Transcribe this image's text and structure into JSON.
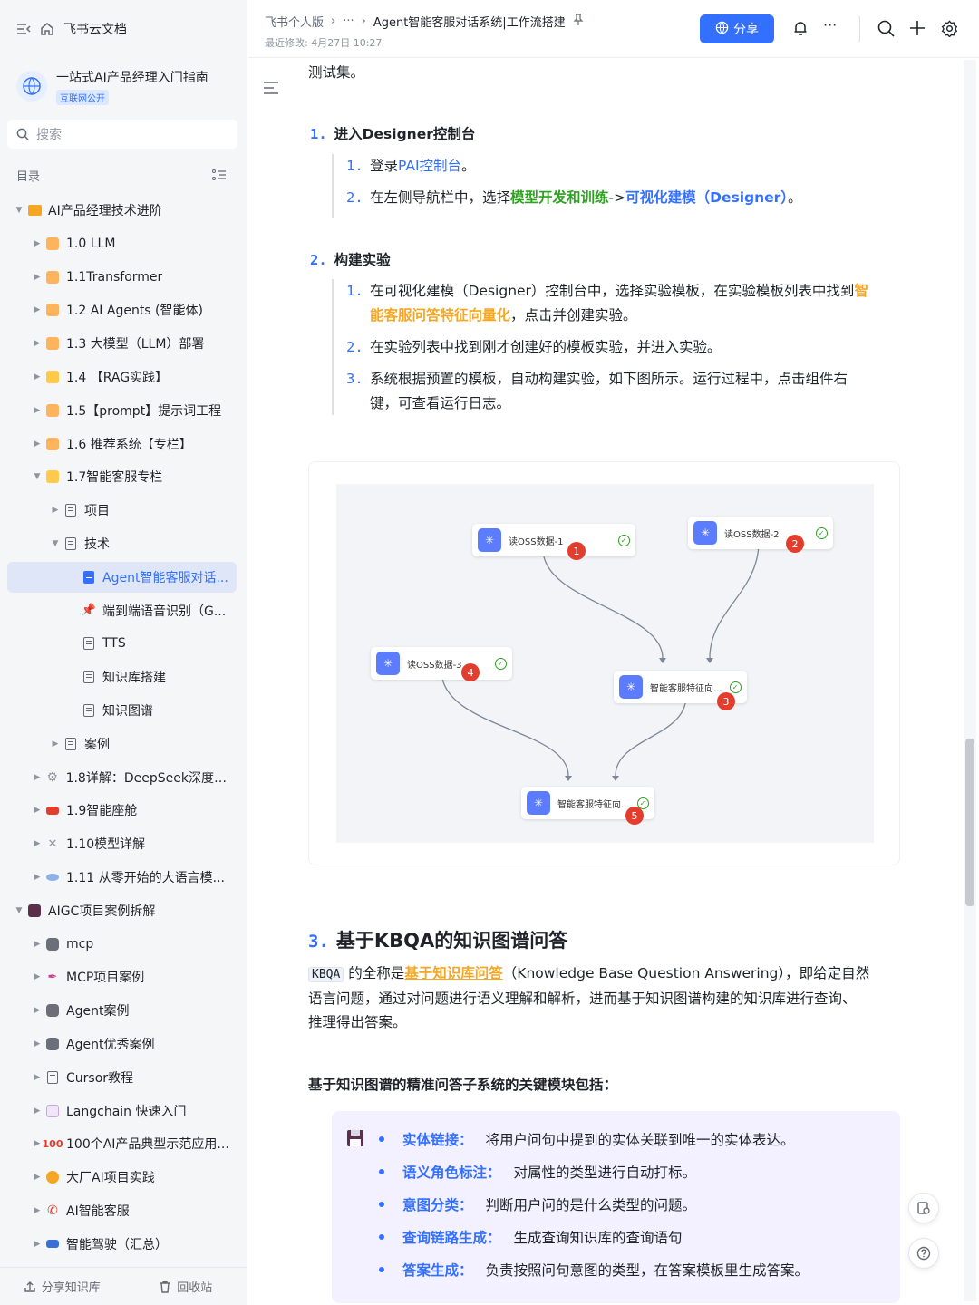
{
  "sidebar": {
    "brand": "飞书云文档",
    "kb_title": "一站式AI产品经理入门指南",
    "kb_badge": "互联网公开",
    "search_placeholder": "搜索",
    "toc_label": "目录",
    "tree": [
      {
        "label": "AI产品经理技术进阶",
        "level": 0,
        "arrow": "▼",
        "icon": "folder"
      },
      {
        "label": "1.0 LLM",
        "level": 1,
        "arrow": "▶",
        "icon": "orange"
      },
      {
        "label": "1.1Transformer",
        "level": 1,
        "arrow": "▶",
        "icon": "orange"
      },
      {
        "label": "1.2 AI Agents (智能体)",
        "level": 1,
        "arrow": "▶",
        "icon": "orange"
      },
      {
        "label": "1.3 大模型（LLM）部署",
        "level": 1,
        "arrow": "▶",
        "icon": "orange"
      },
      {
        "label": "1.4 【RAG实践】",
        "level": 1,
        "arrow": "▶",
        "icon": "yellow"
      },
      {
        "label": "1.5【prompt】提示词工程",
        "level": 1,
        "arrow": "▶",
        "icon": "orange"
      },
      {
        "label": "1.6 推荐系统【专栏】",
        "level": 1,
        "arrow": "▶",
        "icon": "orange"
      },
      {
        "label": "1.7智能客服专栏",
        "level": 1,
        "arrow": "▼",
        "icon": "yellow"
      },
      {
        "label": "项目",
        "level": 2,
        "arrow": "▶",
        "icon": "doc"
      },
      {
        "label": "技术",
        "level": 2,
        "arrow": "▼",
        "icon": "doc"
      },
      {
        "label": "Agent智能客服对话...",
        "level": 3,
        "arrow": "",
        "icon": "doc-blue",
        "active": true
      },
      {
        "label": "端到端语音识别（G...",
        "level": 3,
        "arrow": "",
        "icon": "pin"
      },
      {
        "label": "TTS",
        "level": 3,
        "arrow": "",
        "icon": "doc"
      },
      {
        "label": "知识库搭建",
        "level": 3,
        "arrow": "",
        "icon": "doc"
      },
      {
        "label": "知识图谱",
        "level": 3,
        "arrow": "",
        "icon": "doc"
      },
      {
        "label": "案例",
        "level": 2,
        "arrow": "▶",
        "icon": "doc"
      },
      {
        "label": "1.8详解：DeepSeek深度推...",
        "level": 1,
        "arrow": "▶",
        "icon": "gear"
      },
      {
        "label": "1.9智能座舱",
        "level": 1,
        "arrow": "▶",
        "icon": "car"
      },
      {
        "label": "1.10模型详解",
        "level": 1,
        "arrow": "▶",
        "icon": "tools"
      },
      {
        "label": "1.11 从零开始的大语言模...",
        "level": 1,
        "arrow": "▶",
        "icon": "ufo"
      },
      {
        "label": "AIGC项目案例拆解",
        "level": 0,
        "arrow": "▼",
        "icon": "floppy"
      },
      {
        "label": "mcp",
        "level": 1,
        "arrow": "▶",
        "icon": "robot"
      },
      {
        "label": "MCP项目案例",
        "level": 1,
        "arrow": "▶",
        "icon": "pen"
      },
      {
        "label": "Agent案例",
        "level": 1,
        "arrow": "▶",
        "icon": "robot"
      },
      {
        "label": "Agent优秀案例",
        "level": 1,
        "arrow": "▶",
        "icon": "robot"
      },
      {
        "label": "Cursor教程",
        "level": 1,
        "arrow": "▶",
        "icon": "doc"
      },
      {
        "label": "Langchain 快速入门",
        "level": 1,
        "arrow": "▶",
        "icon": "page"
      },
      {
        "label": "100个AI产品典型示范应用...",
        "level": 1,
        "arrow": "▶",
        "icon": "hundred"
      },
      {
        "label": "大厂AI项目实践",
        "level": 1,
        "arrow": "▶",
        "icon": "medal"
      },
      {
        "label": "AI智能客服",
        "level": 1,
        "arrow": "▶",
        "icon": "phone"
      },
      {
        "label": "智能驾驶（汇总）",
        "level": 1,
        "arrow": "▶",
        "icon": "car2"
      }
    ],
    "share_kb": "分享知识库",
    "recycle": "回收站"
  },
  "header": {
    "crumb_root": "飞书个人版",
    "crumb_more": "···",
    "crumb_current": "Agent智能客服对话系统|工作流搭建",
    "modified": "最近修改: 4月27日 10:27",
    "share": "分享",
    "more": "···"
  },
  "doc": {
    "top_text": "测试集。",
    "step1": {
      "num": "1.",
      "title": "进入Designer控制台",
      "items": [
        {
          "n": "1.",
          "pre": "登录",
          "link": "PAI控制台",
          "post": "。"
        },
        {
          "n": "2.",
          "pre": "在左侧导航栏中，选择",
          "g": "模型开发和训练",
          "mid": "->",
          "b": "可视化建模（Designer）",
          "post": "。"
        }
      ]
    },
    "step2": {
      "num": "2.",
      "title": "构建实验",
      "i1_n": "1.",
      "i1_pre": "在可视化建模（Designer）控制台中，选择实验模板，在实验模板列表中找到",
      "i1_o1": "智",
      "i1_o2": "能客服问答特征向量化",
      "i1_post": "，点击并创建实验。",
      "i2_n": "2.",
      "i2": "在实验列表中找到刚才创建好的模板实验，并进入实验。",
      "i3_n": "3.",
      "i3a": "系统根据预置的模板，自动构建实验，如下图所示。运行过程中，点击组件右",
      "i3b": "键，可查看运行日志。"
    },
    "workflow": {
      "nodes": [
        {
          "label": "读OSS数据-1",
          "badge": "1"
        },
        {
          "label": "读OSS数据-2",
          "badge": "2"
        },
        {
          "label": "读OSS数据-3",
          "badge": "4"
        },
        {
          "label": "智能客服特征向...",
          "badge": "3"
        },
        {
          "label": "智能客服特征向...",
          "badge": "5"
        }
      ]
    },
    "section3": {
      "num": "3.",
      "title": "基于KBQA的知识图谱问答",
      "kbqa": "KBQA",
      "p_pre": "的全称是",
      "p_link": "基于知识库问答",
      "p_post1": "（Knowledge Base Question Answering），即给定自然",
      "p_line2": "语言问题，通过对问题进行语义理解和解析，进而基于知识图谱构建的知识库进行查询、",
      "p_line3": "推理得出答案。",
      "subhead": "基于知识图谱的精准问答子系统的关键模块包括：",
      "modules": [
        {
          "k": "实体链接：",
          "v": "将用户问句中提到的实体关联到唯一的实体表达。"
        },
        {
          "k": "语义角色标注：",
          "v": "对属性的类型进行自动打标。"
        },
        {
          "k": "意图分类：",
          "v": "判断用户问的是什么类型的问题。"
        },
        {
          "k": "查询链路生成：",
          "v": "生成查询知识库的查询语句"
        },
        {
          "k": "答案生成：",
          "v": "负责按照问句意图的类型，在答案模板里生成答案。"
        }
      ]
    }
  }
}
